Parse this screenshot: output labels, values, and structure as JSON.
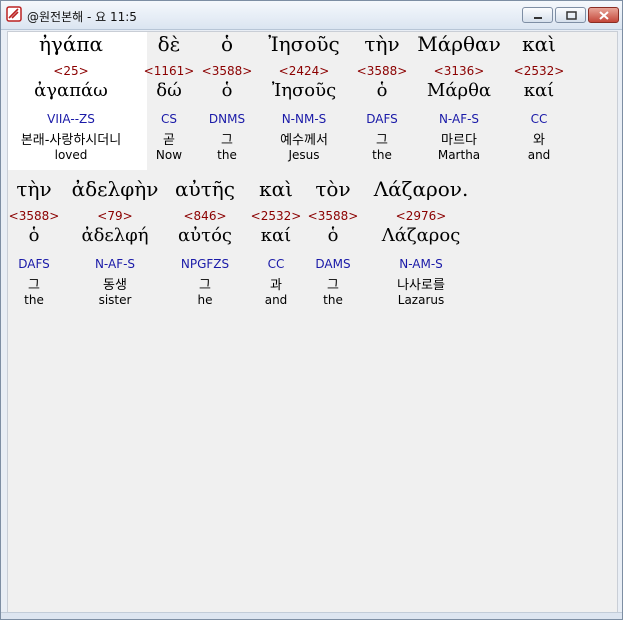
{
  "window": {
    "title": "@원전본해 - 요 11:5"
  },
  "rows": [
    {
      "words": [
        {
          "greek": "ἠγάπα",
          "strong": "<25>",
          "lemma": "ἀγαπάω",
          "parse": "VIIA--ZS",
          "korean": "본래-사랑하시더니",
          "english": "loved",
          "highlighted": true
        },
        {
          "greek": "δὲ",
          "strong": "<1161>",
          "lemma": "δώ",
          "parse": "CS",
          "korean": "곧",
          "english": "Now"
        },
        {
          "greek": "ὁ",
          "strong": "<3588>",
          "lemma": "ὁ",
          "parse": "DNMS",
          "korean": "그",
          "english": "the"
        },
        {
          "greek": "Ἰησοῦς",
          "strong": "<2424>",
          "lemma": "Ἰησοῦς",
          "parse": "N-NM-S",
          "korean": "예수께서",
          "english": "Jesus"
        },
        {
          "greek": "τὴν",
          "strong": "<3588>",
          "lemma": "ὁ",
          "parse": "DAFS",
          "korean": "그",
          "english": "the"
        },
        {
          "greek": "Μάρθαν",
          "strong": "<3136>",
          "lemma": "Μάρθα",
          "parse": "N-AF-S",
          "korean": "마르다",
          "english": "Martha"
        },
        {
          "greek": "καὶ",
          "strong": "<2532>",
          "lemma": "καί",
          "parse": "CC",
          "korean": "와",
          "english": "and"
        }
      ]
    },
    {
      "words": [
        {
          "greek": "τὴν",
          "strong": "<3588>",
          "lemma": "ὁ",
          "parse": "DAFS",
          "korean": "그",
          "english": "the"
        },
        {
          "greek": "ἀδελφὴν",
          "strong": "<79>",
          "lemma": "ἀδελφή",
          "parse": "N-AF-S",
          "korean": "동생",
          "english": "sister"
        },
        {
          "greek": "αὐτῆς",
          "strong": "<846>",
          "lemma": "αὐτός",
          "parse": "NPGFZS",
          "korean": "그",
          "english": "he"
        },
        {
          "greek": "καὶ",
          "strong": "<2532>",
          "lemma": "καί",
          "parse": "CC",
          "korean": "과",
          "english": "and"
        },
        {
          "greek": "τὸν",
          "strong": "<3588>",
          "lemma": "ὁ",
          "parse": "DAMS",
          "korean": "그",
          "english": "the"
        },
        {
          "greek": "Λάζαρον.",
          "strong": "<2976>",
          "lemma": "Λάζαρος",
          "parse": "N-AM-S",
          "korean": "나사로를",
          "english": "Lazarus"
        }
      ]
    }
  ],
  "colors": {
    "strong": "#8b0000",
    "parse": "#1a1aa8",
    "highlight": "#ffffff",
    "background": "#f0f0f0"
  }
}
